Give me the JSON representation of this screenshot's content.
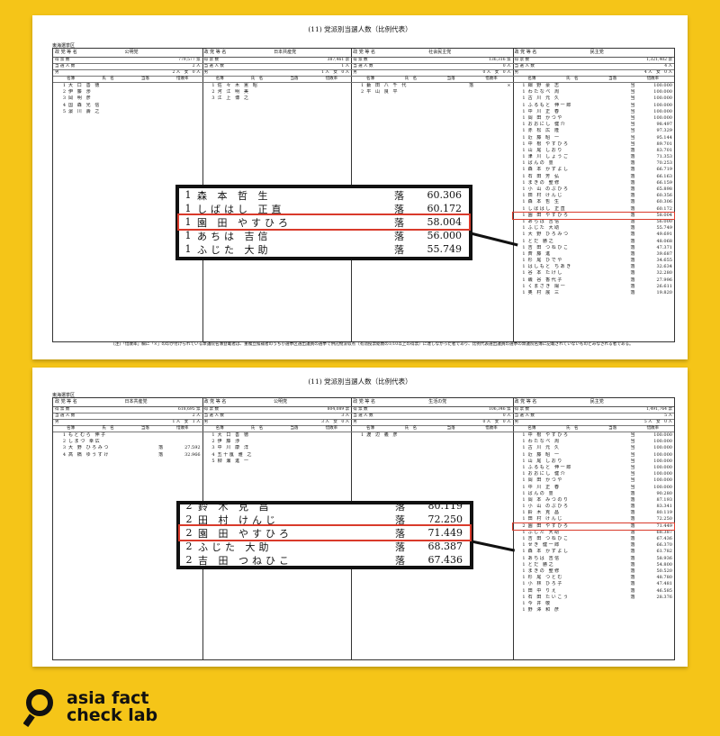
{
  "doc1": {
    "title": "(11) 党派別当選人数（比例代表）",
    "region": "東海選挙区",
    "parties": [
      {
        "label": "政 党 等 名",
        "name": "公明党",
        "votes": "779,577 票",
        "seats": "2 人",
        "gender": "2 人　女　0 人",
        "candidates": [
          [
            "1",
            "大 口 善 徳",
            "",
            ""
          ],
          [
            "2",
            "伊 藤 渉",
            "",
            ""
          ],
          [
            "3",
            "岡 明 彦",
            "",
            ""
          ],
          [
            "4",
            "国 森 光 信",
            "",
            ""
          ],
          [
            "5",
            "濵 川 壽 之",
            "",
            ""
          ]
        ]
      },
      {
        "label": "政 党 等 名",
        "name": "日本共産党",
        "votes": "387,461 票",
        "seats": "1 人",
        "gender": "1 人　女　0 人",
        "candidates": [
          [
            "1",
            "佐 々 木 憲 昭",
            "",
            ""
          ],
          [
            "2",
            "河 江 明 美",
            "",
            ""
          ],
          [
            "3",
            "江 上 博 之",
            "",
            ""
          ]
        ]
      },
      {
        "label": "政 党 等 名",
        "name": "社会民主党",
        "votes": "136,316 票",
        "seats": "0 人",
        "gender": "0 人　女　0 人",
        "candidates": [
          [
            "1",
            "藪 田 八 千 代",
            "落",
            "×"
          ],
          [
            "2",
            "平 山 良 平",
            "",
            ""
          ]
        ]
      },
      {
        "label": "政 党 等 名",
        "name": "民主党",
        "votes": "1,321,402 票",
        "seats": "4 人",
        "gender": "4 人　女　0 人",
        "candidates": [
          [
            "1",
            "細 野 豪 志",
            "当",
            "100.000"
          ],
          [
            "1",
            "わたなべ 周",
            "当",
            "100.000"
          ],
          [
            "1",
            "古 川 元 久",
            "当",
            "100.000"
          ],
          [
            "1",
            "ふるもと 伸一郎",
            "当",
            "100.000"
          ],
          [
            "1",
            "中 川 正 春",
            "当",
            "100.000"
          ],
          [
            "1",
            "岡 田 かつや",
            "当",
            "100.000"
          ],
          [
            "1",
            "おおにし 健介",
            "当",
            "98.497"
          ],
          [
            "1",
            "赤 松 広 隆",
            "当",
            "97.329"
          ],
          [
            "1",
            "近 藤 昭 一",
            "当",
            "95.144"
          ],
          [
            "1",
            "中 根 やすひろ",
            "当",
            "89.701"
          ],
          [
            "1",
            "山 尾 しおり",
            "落",
            "83.701"
          ],
          [
            "1",
            "津 川 しょうご",
            "落",
            "71.353"
          ],
          [
            "1",
            "ばんの 豊",
            "落",
            "70.253"
          ],
          [
            "1",
            "森 本 かずよし",
            "落",
            "66.719"
          ],
          [
            "1",
            "石 田 芳 弘",
            "落",
            "66.163"
          ],
          [
            "1",
            "まきの 聖修",
            "落",
            "66.159"
          ],
          [
            "1",
            "小 山 のぶひろ",
            "落",
            "65.898"
          ],
          [
            "1",
            "田 村 けんじ",
            "落",
            "60.356"
          ],
          [
            "1",
            "森 本 哲 生",
            "落",
            "60.306"
          ],
          [
            "1",
            "しばはし 正直",
            "落",
            "60.172"
          ],
          [
            "1",
            "園 田 やすひろ",
            "落",
            "58.004"
          ],
          [
            "1",
            "あちは 吉信",
            "落",
            "56.000"
          ],
          [
            "1",
            "ふじた 大助",
            "落",
            "55.749"
          ],
          [
            "1",
            "大 野 ひろみつ",
            "落",
            "49.691"
          ],
          [
            "1",
            "とだ 勝之",
            "落",
            "48.068"
          ],
          [
            "1",
            "吉 田 つねひこ",
            "落",
            "47.371"
          ],
          [
            "1",
            "斉 藤 進",
            "落",
            "39.687"
          ],
          [
            "1",
            "杉 尾 ひでや",
            "落",
            "34.655"
          ],
          [
            "1",
            "はしもと ちあき",
            "落",
            "32.634"
          ],
          [
            "1",
            "谷 本 たけし",
            "落",
            "32.280"
          ],
          [
            "1",
            "磯 谷 香代子",
            "落",
            "27.996"
          ],
          [
            "1",
            "くまざき 陽一",
            "落",
            "26.611"
          ],
          [
            "1",
            "奥 村 展 三",
            "落",
            "19.820"
          ]
        ]
      }
    ],
    "note": "(注)「惜敗率」欄に「×」の印が付けられている衆議院名簿登載者は、重複立候補者のうち小選挙区選出議員の選挙で供託物没収点（有効投票総数の1/10以上の得票）に達しなかった者であり、比例代表選出議員の選挙の衆議院名簿に記載されていないものとみなされる者である。"
  },
  "doc2": {
    "title": "(11) 党派別当選人数（比例代表）",
    "region": "東海選挙区",
    "parties": [
      {
        "label": "政 党 等 名",
        "name": "日本共産党",
        "votes": "618,695 票",
        "seats": "2 人",
        "gender": "1 人　女　1 人",
        "candidates": [
          [
            "1",
            "もとむら 伸子",
            "",
            ""
          ],
          [
            "2",
            "しまづ 幸広",
            "",
            ""
          ],
          [
            "3",
            "大 野 ひろみつ",
            "落",
            "27.592"
          ],
          [
            "4",
            "高 橋 ゆうすけ",
            "落",
            "32.966"
          ]
        ]
      },
      {
        "label": "政 党 等 名",
        "name": "公明党",
        "votes": "804,089 票",
        "seats": "3 人",
        "gender": "3 人　女　0 人",
        "candidates": [
          [
            "1",
            "大 口 善 徳",
            "",
            ""
          ],
          [
            "2",
            "伊 藤 渉",
            "",
            ""
          ],
          [
            "3",
            "中 川 康 洋",
            "",
            ""
          ],
          [
            "4",
            "五十嵐 雅 之",
            "",
            ""
          ],
          [
            "5",
            "柳 瀬 進 一",
            "",
            ""
          ]
        ]
      },
      {
        "label": "政 党 等 名",
        "name": "生活の党",
        "votes": "106,346 票",
        "seats": "0 人",
        "gender": "0 人　女　0 人",
        "candidates": [
          [
            "1",
            "渡 辺 義 彦",
            "",
            ""
          ]
        ]
      },
      {
        "label": "政 党 等 名",
        "name": "民主党",
        "votes": "1,491,764 票",
        "seats": "5 人",
        "gender": "5 人　女　0 人",
        "candidates": [
          [
            "1",
            "中 根 やすひろ",
            "当",
            "100.000"
          ],
          [
            "1",
            "わたなべ 周",
            "当",
            "100.000"
          ],
          [
            "1",
            "古 川 元 久",
            "当",
            "100.000"
          ],
          [
            "1",
            "近 藤 昭 一",
            "当",
            "100.000"
          ],
          [
            "1",
            "山 尾 しおり",
            "当",
            "100.000"
          ],
          [
            "1",
            "ふるもと 伸一郎",
            "当",
            "100.000"
          ],
          [
            "1",
            "おおにし 健介",
            "当",
            "100.000"
          ],
          [
            "1",
            "岡 田 かつや",
            "当",
            "100.000"
          ],
          [
            "1",
            "中 川 正 春",
            "当",
            "100.000"
          ],
          [
            "1",
            "ばんの 豊",
            "落",
            "90.280"
          ],
          [
            "1",
            "岡 本 みつのり",
            "落",
            "87.193"
          ],
          [
            "1",
            "小 山 のぶひろ",
            "落",
            "83.341"
          ],
          [
            "1",
            "鈴 木 克 昌",
            "落",
            "80.119"
          ],
          [
            "1",
            "田 村 けんじ",
            "落",
            "72.250"
          ],
          [
            "2",
            "園 田 やすひろ",
            "落",
            "71.449"
          ],
          [
            "1",
            "ふじた 大助",
            "落",
            "68.387"
          ],
          [
            "1",
            "吉 田 つねひこ",
            "落",
            "67.436"
          ],
          [
            "1",
            "せき 健一郎",
            "落",
            "66.370"
          ],
          [
            "1",
            "森 本 かずよし",
            "落",
            "61.782"
          ],
          [
            "1",
            "あちは 吉信",
            "落",
            "58.936"
          ],
          [
            "1",
            "とだ 勝之",
            "落",
            "54.800"
          ],
          [
            "1",
            "まきの 聖修",
            "落",
            "50.520"
          ],
          [
            "1",
            "杉 尾 つとむ",
            "落",
            "48.780"
          ],
          [
            "1",
            "小 林 ひろ子",
            "落",
            "47.481"
          ],
          [
            "1",
            "田 中 りえ",
            "落",
            "46.585"
          ],
          [
            "1",
            "石 田 たいこう",
            "落",
            "28.376"
          ],
          [
            "1",
            "今 井 敬",
            "",
            ""
          ],
          [
            "1",
            "野 澤 和 彦",
            "",
            ""
          ]
        ]
      }
    ]
  },
  "zoom1": {
    "rows": [
      [
        "1",
        "森 本 哲 生",
        "落",
        "60.306"
      ],
      [
        "1",
        "しばはし 正直",
        "落",
        "60.172"
      ],
      [
        "1",
        "園 田 やすひろ",
        "落",
        "58.004"
      ],
      [
        "1",
        "あちは 吉信",
        "落",
        "56.000"
      ],
      [
        "1",
        "ふじた 大助",
        "落",
        "55.749"
      ]
    ]
  },
  "zoom2": {
    "rows": [
      [
        "2",
        "鈴 木 克 昌",
        "落",
        "80.119"
      ],
      [
        "2",
        "田 村 けんじ",
        "落",
        "72.250"
      ],
      [
        "2",
        "園 田 やすひろ",
        "落",
        "71.449"
      ],
      [
        "2",
        "ふじた 大助",
        "落",
        "68.387"
      ],
      [
        "2",
        "吉 田 つねひこ",
        "落",
        "67.436"
      ]
    ]
  },
  "logo": {
    "line1": "asia fact",
    "line2": "check lab",
    "icon": "magnifier-logo-icon"
  },
  "colors": {
    "background": "#f5c518",
    "highlight": "#d93a2b",
    "frame": "#111111"
  }
}
